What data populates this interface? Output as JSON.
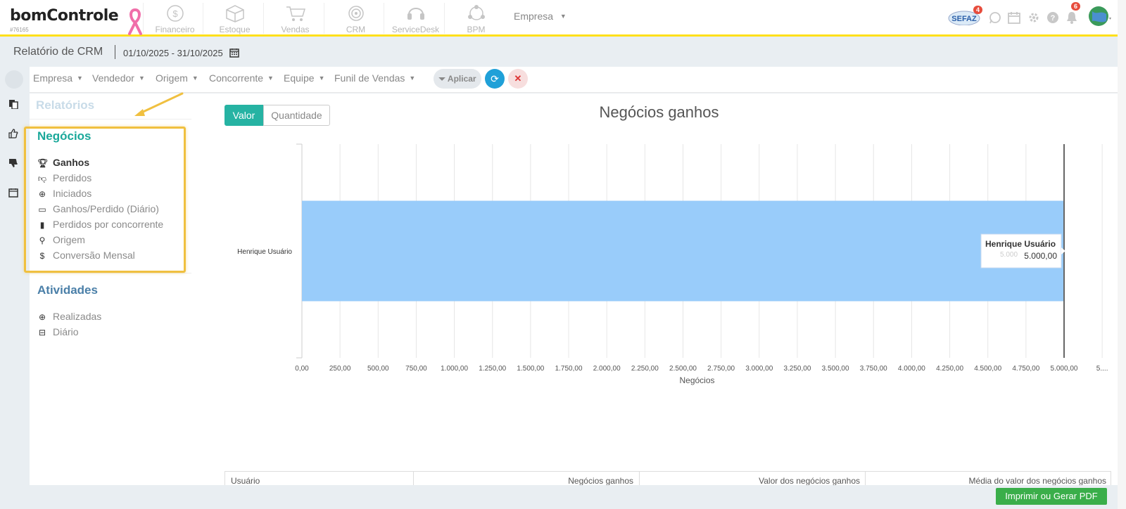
{
  "header": {
    "logo": "bomControle",
    "account_id": "#76165",
    "modules": [
      {
        "label": "Financeiro",
        "icon": "dollar-circle-icon"
      },
      {
        "label": "Estoque",
        "icon": "box-icon"
      },
      {
        "label": "Vendas",
        "icon": "cart-icon"
      },
      {
        "label": "CRM",
        "icon": "target-icon"
      },
      {
        "label": "ServiceDesk",
        "icon": "headset-icon"
      },
      {
        "label": "BPM",
        "icon": "network-icon"
      }
    ],
    "empresa_label": "Empresa",
    "sefaz_label": "SEFAZ",
    "sefaz_badge": "4",
    "notification_badge": "6"
  },
  "subheader": {
    "title": "Relatório de CRM",
    "date_range": "01/10/2025 - 31/10/2025"
  },
  "filters": {
    "items": [
      "Empresa",
      "Vendedor",
      "Origem",
      "Concorrente",
      "Equipe",
      "Funil de Vendas"
    ],
    "apply_label": "Aplicar"
  },
  "sidebar": {
    "relatorios_title": "Relatórios",
    "negocios_title": "Negócios",
    "negocios_items": [
      {
        "label": "Ganhos",
        "icon": "trophy-icon"
      },
      {
        "label": "Perdidos",
        "icon": "thumbs-down-icon"
      },
      {
        "label": "Iniciados",
        "icon": "plus-circle-icon"
      },
      {
        "label": "Ganhos/Perdido (Diário)",
        "icon": "calendar-icon"
      },
      {
        "label": "Perdidos por concorrente",
        "icon": "building-icon"
      },
      {
        "label": "Origem",
        "icon": "map-pin-icon"
      },
      {
        "label": "Conversão Mensal",
        "icon": "dollar-icon"
      }
    ],
    "atividades_title": "Atividades",
    "atividades_items": [
      {
        "label": "Realizadas",
        "icon": "plus-circle-icon"
      },
      {
        "label": "Diário",
        "icon": "calendar-minus-icon"
      }
    ]
  },
  "toggle": {
    "valor": "Valor",
    "quantidade": "Quantidade"
  },
  "chart_data": {
    "type": "bar",
    "orientation": "horizontal",
    "title": "Negócios ganhos",
    "xlabel": "Negócios",
    "ylabel": "",
    "categories": [
      "Henrique Usuário"
    ],
    "values": [
      5000
    ],
    "xlim": [
      0,
      5000
    ],
    "x_ticks": [
      "0,00",
      "250,00",
      "500,00",
      "750,00",
      "1.000,00",
      "1.250,00",
      "1.500,00",
      "1.750,00",
      "2.000,00",
      "2.250,00",
      "2.500,00",
      "2.750,00",
      "3.000,00",
      "3.250,00",
      "3.500,00",
      "3.750,00",
      "4.000,00",
      "4.250,00",
      "4.500,00",
      "4.750,00",
      "5.000,00",
      "5...."
    ],
    "bar_color": "#99ccfa",
    "grid": true,
    "tooltip": {
      "name": "Henrique Usuário",
      "value": "5.000,00",
      "ghost": "5.000"
    }
  },
  "table": {
    "headers": [
      "Usuário",
      "Negócios ganhos",
      "Valor dos negócios ganhos",
      "Média do valor dos negócios ganhos"
    ]
  },
  "footer": {
    "pdf_label": "Imprimir ou Gerar PDF"
  },
  "colors": {
    "accent": "#26b3a3",
    "topbar_border": "#ffe01a",
    "pdf_button": "#3aae4a"
  }
}
